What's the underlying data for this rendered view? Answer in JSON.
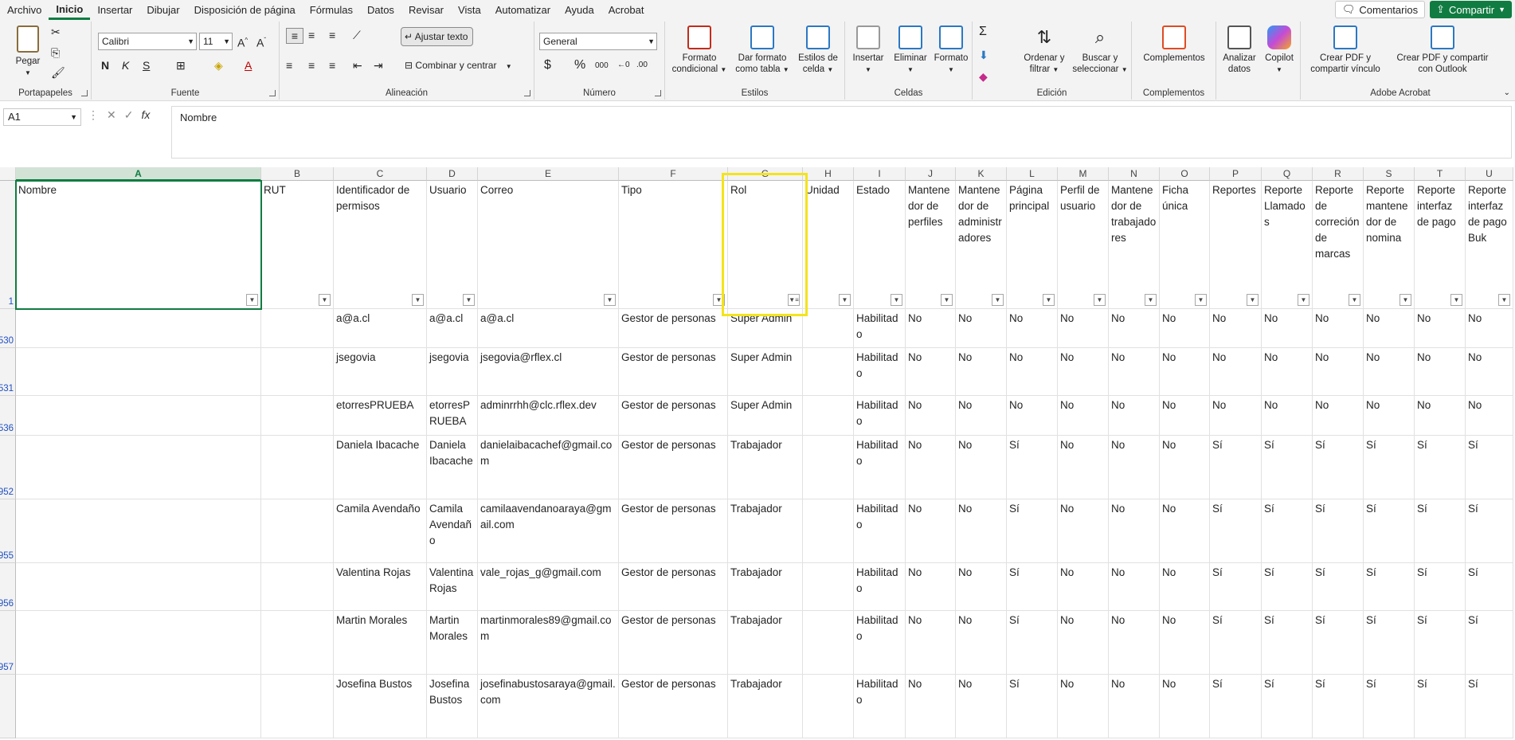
{
  "menu": {
    "tabs": [
      "Archivo",
      "Inicio",
      "Insertar",
      "Dibujar",
      "Disposición de página",
      "Fórmulas",
      "Datos",
      "Revisar",
      "Vista",
      "Automatizar",
      "Ayuda",
      "Acrobat"
    ],
    "active": "Inicio",
    "comments_label": "Comentarios",
    "share_label": "Compartir"
  },
  "ribbon": {
    "portapapeles": {
      "label": "Portapapeles",
      "paste": "Pegar"
    },
    "fuente": {
      "label": "Fuente",
      "font_name": "Calibri",
      "font_size": "11",
      "bold": "N",
      "italic": "K",
      "underline": "S"
    },
    "alineacion": {
      "label": "Alineación",
      "wrap_text": "Ajustar texto",
      "merge_center": "Combinar y centrar"
    },
    "numero": {
      "label": "Número",
      "format": "General",
      "currency": "$",
      "percent": "%",
      "thousands": "000"
    },
    "estilos": {
      "label": "Estilos",
      "conditional": [
        "Formato",
        "condicional"
      ],
      "as_table": [
        "Dar formato",
        "como tabla"
      ],
      "cell_styles": [
        "Estilos de",
        "celda"
      ]
    },
    "celdas": {
      "label": "Celdas",
      "insert": "Insertar",
      "delete": "Eliminar",
      "format": "Formato"
    },
    "edicion": {
      "label": "Edición",
      "sort_filter": [
        "Ordenar y",
        "filtrar"
      ],
      "find_select": [
        "Buscar y",
        "seleccionar"
      ]
    },
    "complementos": {
      "label": "Complementos",
      "addins": "Complementos"
    },
    "extra": {
      "analyze": [
        "Analizar",
        "datos"
      ],
      "copilot": "Copilot"
    },
    "acrobat": {
      "label": "Adobe Acrobat",
      "create_pdf": [
        "Crear PDF y",
        "compartir vínculo"
      ],
      "create_pdf_outlook": [
        "Crear PDF y compartir",
        "con Outlook"
      ]
    }
  },
  "formula_bar": {
    "name_box": "A1",
    "fx": "fx",
    "content": "Nombre"
  },
  "colors": {
    "accent": "#107c41",
    "highlight": "#f4e41c",
    "rownum": "#1f4fc1"
  },
  "sheet": {
    "columns": [
      "A",
      "B",
      "C",
      "D",
      "E",
      "F",
      "G",
      "H",
      "I",
      "J",
      "K",
      "L",
      "M",
      "N",
      "O",
      "P",
      "Q",
      "R",
      "S",
      "T",
      "U"
    ],
    "header_row_number": "1",
    "headers": [
      "Nombre",
      "RUT",
      "Identificador de permisos",
      "Usuario",
      "Correo",
      "Tipo",
      "Rol",
      "Unidad",
      "Estado",
      "Mantenedor de perfiles",
      "Mantenedor de administradores",
      "Página principal",
      "Perfil de usuario",
      "Mantenedor de trabajadores",
      "Ficha única",
      "Reportes",
      "Reporte Llamados",
      "Reporte de correción de marcas",
      "Reporte mantenedor de nomina",
      "Reporte interfaz de pago",
      "Reporte interfaz de pago Buk"
    ],
    "rows": [
      {
        "num": "530",
        "cells": [
          "",
          "",
          "a@a.cl",
          "a@a.cl",
          "a@a.cl",
          "Gestor de personas",
          "Super Admin",
          "",
          "Habilitado",
          "No",
          "No",
          "No",
          "No",
          "No",
          "No",
          "No",
          "No",
          "No",
          "No",
          "No",
          "No"
        ]
      },
      {
        "num": "531",
        "cells": [
          "",
          "",
          "jsegovia",
          "jsegovia",
          "jsegovia@rflex.cl",
          "Gestor de personas",
          "Super Admin",
          "",
          "Habilitado",
          "No",
          "No",
          "No",
          "No",
          "No",
          "No",
          "No",
          "No",
          "No",
          "No",
          "No",
          "No"
        ]
      },
      {
        "num": "536",
        "cells": [
          "",
          "",
          "etorresPRUEBA",
          "etorresPRUEBA",
          "adminrrhh@clc.rflex.dev",
          "Gestor de personas",
          "Super Admin",
          "",
          "Habilitado",
          "No",
          "No",
          "No",
          "No",
          "No",
          "No",
          "No",
          "No",
          "No",
          "No",
          "No",
          "No"
        ]
      },
      {
        "num": "952",
        "cells": [
          "",
          "",
          "Daniela Ibacache",
          "Daniela Ibacache",
          "danielaibacachef@gmail.com",
          "Gestor de personas",
          "Trabajador",
          "",
          "Habilitado",
          "No",
          "No",
          "Sí",
          "No",
          "No",
          "No",
          "Sí",
          "Sí",
          "Sí",
          "Sí",
          "Sí",
          "Sí"
        ]
      },
      {
        "num": "955",
        "cells": [
          "",
          "",
          "Camila Avendaño",
          "Camila Avendaño",
          "camilaavendanoaraya@gmail.com",
          "Gestor de personas",
          "Trabajador",
          "",
          "Habilitado",
          "No",
          "No",
          "Sí",
          "No",
          "No",
          "No",
          "Sí",
          "Sí",
          "Sí",
          "Sí",
          "Sí",
          "Sí"
        ]
      },
      {
        "num": "956",
        "cells": [
          "",
          "",
          "Valentina Rojas",
          "Valentina Rojas",
          "vale_rojas_g@gmail.com",
          "Gestor de personas",
          "Trabajador",
          "",
          "Habilitado",
          "No",
          "No",
          "Sí",
          "No",
          "No",
          "No",
          "Sí",
          "Sí",
          "Sí",
          "Sí",
          "Sí",
          "Sí"
        ]
      },
      {
        "num": "957",
        "cells": [
          "",
          "",
          "Martin Morales",
          "Martin Morales",
          "martinmorales89@gmail.com",
          "Gestor de personas",
          "Trabajador",
          "",
          "Habilitado",
          "No",
          "No",
          "Sí",
          "No",
          "No",
          "No",
          "Sí",
          "Sí",
          "Sí",
          "Sí",
          "Sí",
          "Sí"
        ]
      },
      {
        "num": "",
        "cells": [
          "",
          "",
          "Josefina Bustos",
          "Josefina Bustos",
          "josefinabustosaraya@gmail.com",
          "Gestor de personas",
          "Trabajador",
          "",
          "Habilitado",
          "No",
          "No",
          "Sí",
          "No",
          "No",
          "No",
          "Sí",
          "Sí",
          "Sí",
          "Sí",
          "Sí",
          "Sí"
        ]
      }
    ]
  }
}
